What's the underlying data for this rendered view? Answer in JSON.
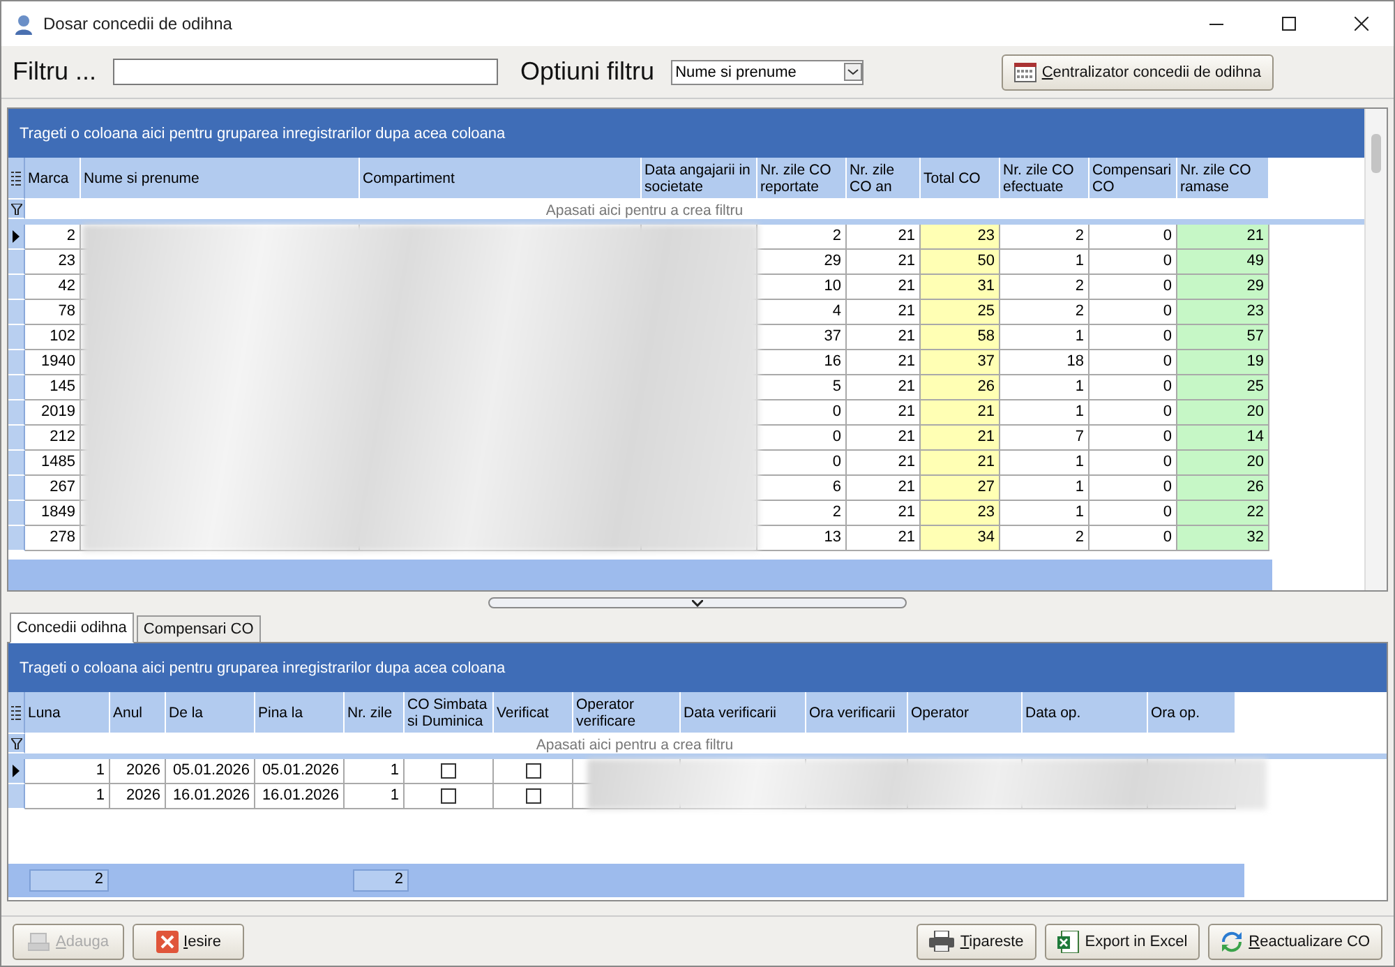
{
  "window": {
    "title": "Dosar concedii de odihna"
  },
  "filter": {
    "label": "Filtru ...",
    "options_label": "Optiuni filtru",
    "option": "Nume si prenume"
  },
  "summary_button": {
    "label": "Centralizator concedii de odihna",
    "mnemonic": true
  },
  "upper_grid": {
    "group_hint": "Trageti o coloana aici pentru gruparea inregistrarilor dupa acea coloana",
    "filter_hint": "Apasati aici pentru a  crea filtru",
    "columns": [
      {
        "label": "Marca"
      },
      {
        "label": "Nume si prenume"
      },
      {
        "label": "Compartiment"
      },
      {
        "label": "Data angajarii in societate"
      },
      {
        "label": "Nr. zile CO reportate"
      },
      {
        "label": "Nr. zile CO  an"
      },
      {
        "label": "Total CO",
        "color": "#ffffb4"
      },
      {
        "label": "Nr. zile CO efectuate"
      },
      {
        "label": "Compensari CO"
      },
      {
        "label": "Nr. zile CO ramase",
        "color": "#c6f7c6"
      }
    ],
    "rows": [
      {
        "selected": true,
        "marca": "2",
        "values": [
          "2",
          "21",
          "23",
          "2",
          "0",
          "21"
        ]
      },
      {
        "selected": false,
        "marca": "23",
        "values": [
          "29",
          "21",
          "50",
          "1",
          "0",
          "49"
        ]
      },
      {
        "selected": false,
        "marca": "42",
        "values": [
          "10",
          "21",
          "31",
          "2",
          "0",
          "29"
        ]
      },
      {
        "selected": false,
        "marca": "78",
        "values": [
          "4",
          "21",
          "25",
          "2",
          "0",
          "23"
        ]
      },
      {
        "selected": false,
        "marca": "102",
        "values": [
          "37",
          "21",
          "58",
          "1",
          "0",
          "57"
        ]
      },
      {
        "selected": false,
        "marca": "1940",
        "values": [
          "16",
          "21",
          "37",
          "18",
          "0",
          "19"
        ]
      },
      {
        "selected": false,
        "marca": "145",
        "values": [
          "5",
          "21",
          "26",
          "1",
          "0",
          "25"
        ]
      },
      {
        "selected": false,
        "marca": "2019",
        "values": [
          "0",
          "21",
          "21",
          "1",
          "0",
          "20"
        ]
      },
      {
        "selected": false,
        "marca": "212",
        "values": [
          "0",
          "21",
          "21",
          "7",
          "0",
          "14"
        ]
      },
      {
        "selected": false,
        "marca": "1485",
        "values": [
          "0",
          "21",
          "21",
          "1",
          "0",
          "20"
        ]
      },
      {
        "selected": false,
        "marca": "267",
        "values": [
          "6",
          "21",
          "27",
          "1",
          "0",
          "26"
        ]
      },
      {
        "selected": false,
        "marca": "1849",
        "values": [
          "2",
          "21",
          "23",
          "1",
          "0",
          "22"
        ]
      },
      {
        "selected": false,
        "marca": "278",
        "values": [
          "13",
          "21",
          "34",
          "2",
          "0",
          "32"
        ]
      }
    ]
  },
  "tabs": [
    {
      "label": "Concedii odihna",
      "selected": true
    },
    {
      "label": "Compensari CO",
      "selected": false
    }
  ],
  "lower_grid": {
    "group_hint": "Trageti o coloana aici pentru gruparea inregistrarilor dupa acea coloana",
    "filter_hint": "Apasati aici pentru a  crea filtru",
    "columns": [
      "Luna",
      "Anul",
      "De la",
      "Pina la",
      "Nr. zile",
      "CO Simbata si Duminica",
      "Verificat",
      "Operator verificare",
      "Data verificarii",
      "Ora verificarii",
      "Operator",
      "Data op.",
      "Ora op."
    ],
    "rows": [
      {
        "selected": true,
        "luna": "1",
        "anul": "2026",
        "de_la": "05.01.2026",
        "pina_la": "05.01.2026",
        "nr_zile": "1",
        "weekend": false,
        "verificat": false
      },
      {
        "selected": false,
        "luna": "1",
        "anul": "2026",
        "de_la": "16.01.2026",
        "pina_la": "16.01.2026",
        "nr_zile": "1",
        "weekend": false,
        "verificat": false
      }
    ],
    "totals": {
      "luna": "2",
      "nr_zile": "2"
    }
  },
  "buttons": [
    {
      "kind": "add",
      "label": "Adauga",
      "disabled": true,
      "mnemonic": true
    },
    {
      "kind": "exit",
      "label": "Iesire",
      "disabled": false,
      "mnemonic": true
    },
    {
      "kind": "print",
      "label": "Tipareste",
      "disabled": false,
      "mnemonic": true
    },
    {
      "kind": "excel",
      "label": "Export in Excel",
      "disabled": false,
      "mnemonic": false
    },
    {
      "kind": "refresh",
      "label": "Reactualizare CO",
      "disabled": false,
      "mnemonic": true
    }
  ]
}
